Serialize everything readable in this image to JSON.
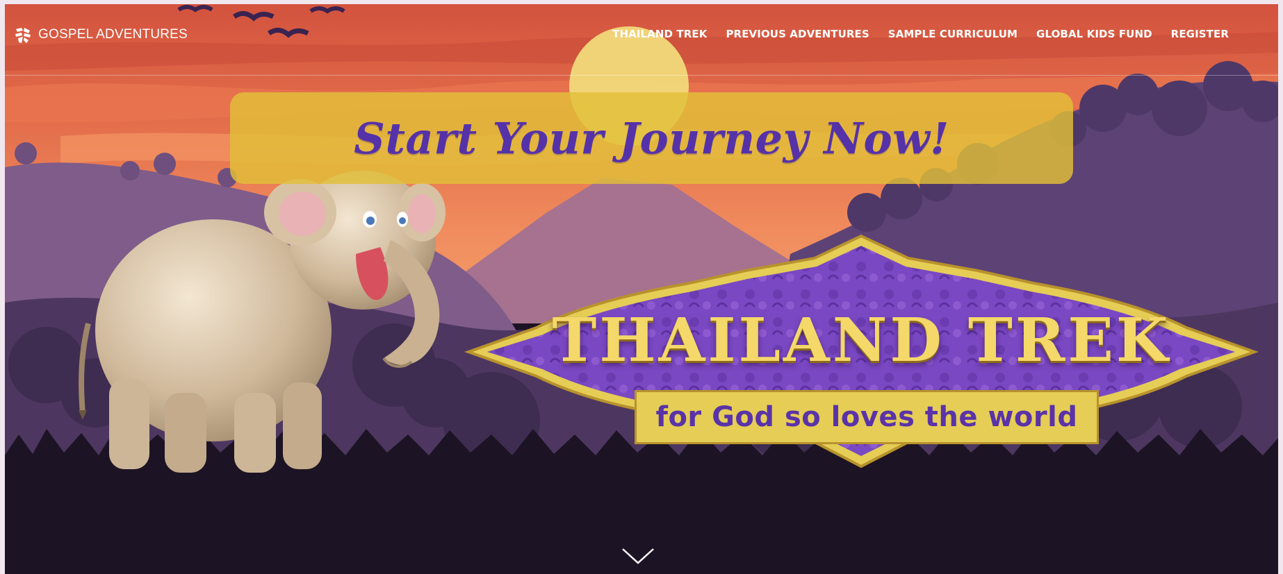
{
  "brand": {
    "name": "GOSPEL ADVENTURES",
    "logo_icon": "gospel-adventures-logo-icon"
  },
  "nav": {
    "items": [
      {
        "label": "THAILAND TREK"
      },
      {
        "label": "PREVIOUS ADVENTURES"
      },
      {
        "label": "SAMPLE CURRICULUM"
      },
      {
        "label": "GLOBAL KIDS FUND"
      },
      {
        "label": "REGISTER"
      }
    ]
  },
  "hero": {
    "cta_label": "Start Your Journey Now!",
    "title": "THAILAND TREK",
    "subtitle": "for God so loves the world",
    "scroll_icon": "chevron-down-icon"
  },
  "colors": {
    "sky_top": "#d9593f",
    "sky_mid": "#ef8458",
    "hills": "#8a5f85",
    "foreground": "#1c1424",
    "cta_bg": "#e2c038",
    "cta_text": "#5532a8",
    "badge_purple": "#7a48c2",
    "badge_gold": "#e5cd56"
  }
}
